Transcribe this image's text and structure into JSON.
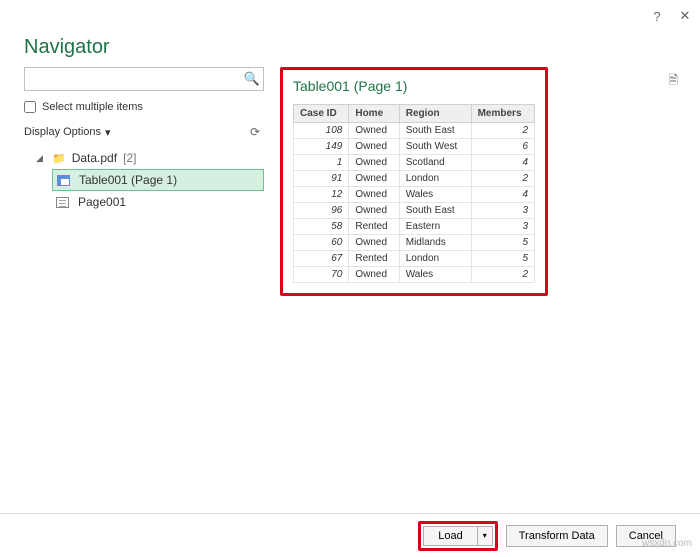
{
  "titlebar": {
    "help_icon": "?",
    "close_icon": "✕"
  },
  "header": {
    "title": "Navigator"
  },
  "search": {
    "placeholder": "",
    "icon_name": "search-icon"
  },
  "options": {
    "select_multiple_label": "Select multiple items",
    "display_options_label": "Display Options",
    "caret": "▾"
  },
  "tree": {
    "root": {
      "caret": "◢",
      "name": "Data.pdf",
      "count": "[2]"
    },
    "items": [
      {
        "label": "Table001 (Page 1)",
        "selected": true,
        "type": "table"
      },
      {
        "label": "Page001",
        "selected": false,
        "type": "page"
      }
    ]
  },
  "preview": {
    "title": "Table001 (Page 1)",
    "columns": [
      "Case ID",
      "Home",
      "Region",
      "Members"
    ]
  },
  "chart_data": {
    "type": "table",
    "columns": [
      "Case ID",
      "Home",
      "Region",
      "Members"
    ],
    "rows": [
      [
        108,
        "Owned",
        "South East",
        2
      ],
      [
        149,
        "Owned",
        "South West",
        6
      ],
      [
        1,
        "Owned",
        "Scotland",
        4
      ],
      [
        91,
        "Owned",
        "London",
        2
      ],
      [
        12,
        "Owned",
        "Wales",
        4
      ],
      [
        96,
        "Owned",
        "South East",
        3
      ],
      [
        58,
        "Rented",
        "Eastern",
        3
      ],
      [
        60,
        "Owned",
        "Midlands",
        5
      ],
      [
        67,
        "Rented",
        "London",
        5
      ],
      [
        70,
        "Owned",
        "Wales",
        2
      ]
    ]
  },
  "footer": {
    "load_label": "Load",
    "load_caret": "▾",
    "transform_label": "Transform Data",
    "cancel_label": "Cancel"
  },
  "watermark": "wsxdn.com"
}
